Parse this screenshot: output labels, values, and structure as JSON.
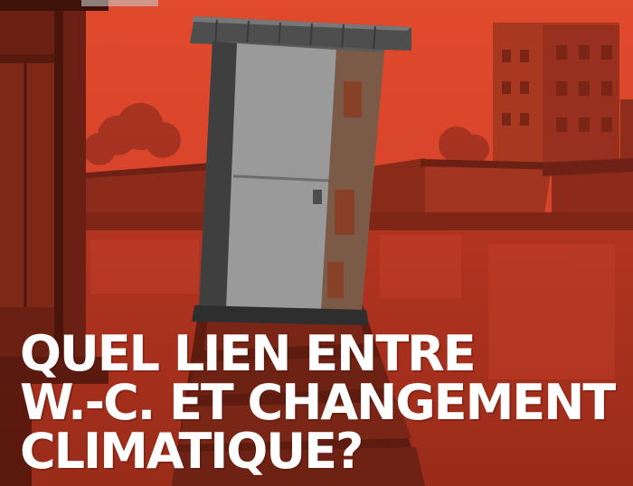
{
  "headline": {
    "line1": "QUEL LIEN ENTRE",
    "line2": "W.-C. ET CHANGEMENT",
    "line3": "CLIMATIQUE?"
  },
  "colors": {
    "sky": "#e2492c",
    "water": "#b8361f",
    "shadow": "#5a1a10",
    "headline_text": "#ffffff"
  },
  "scene": {
    "subject": "latrine-icon",
    "background": "flooded-slum"
  }
}
